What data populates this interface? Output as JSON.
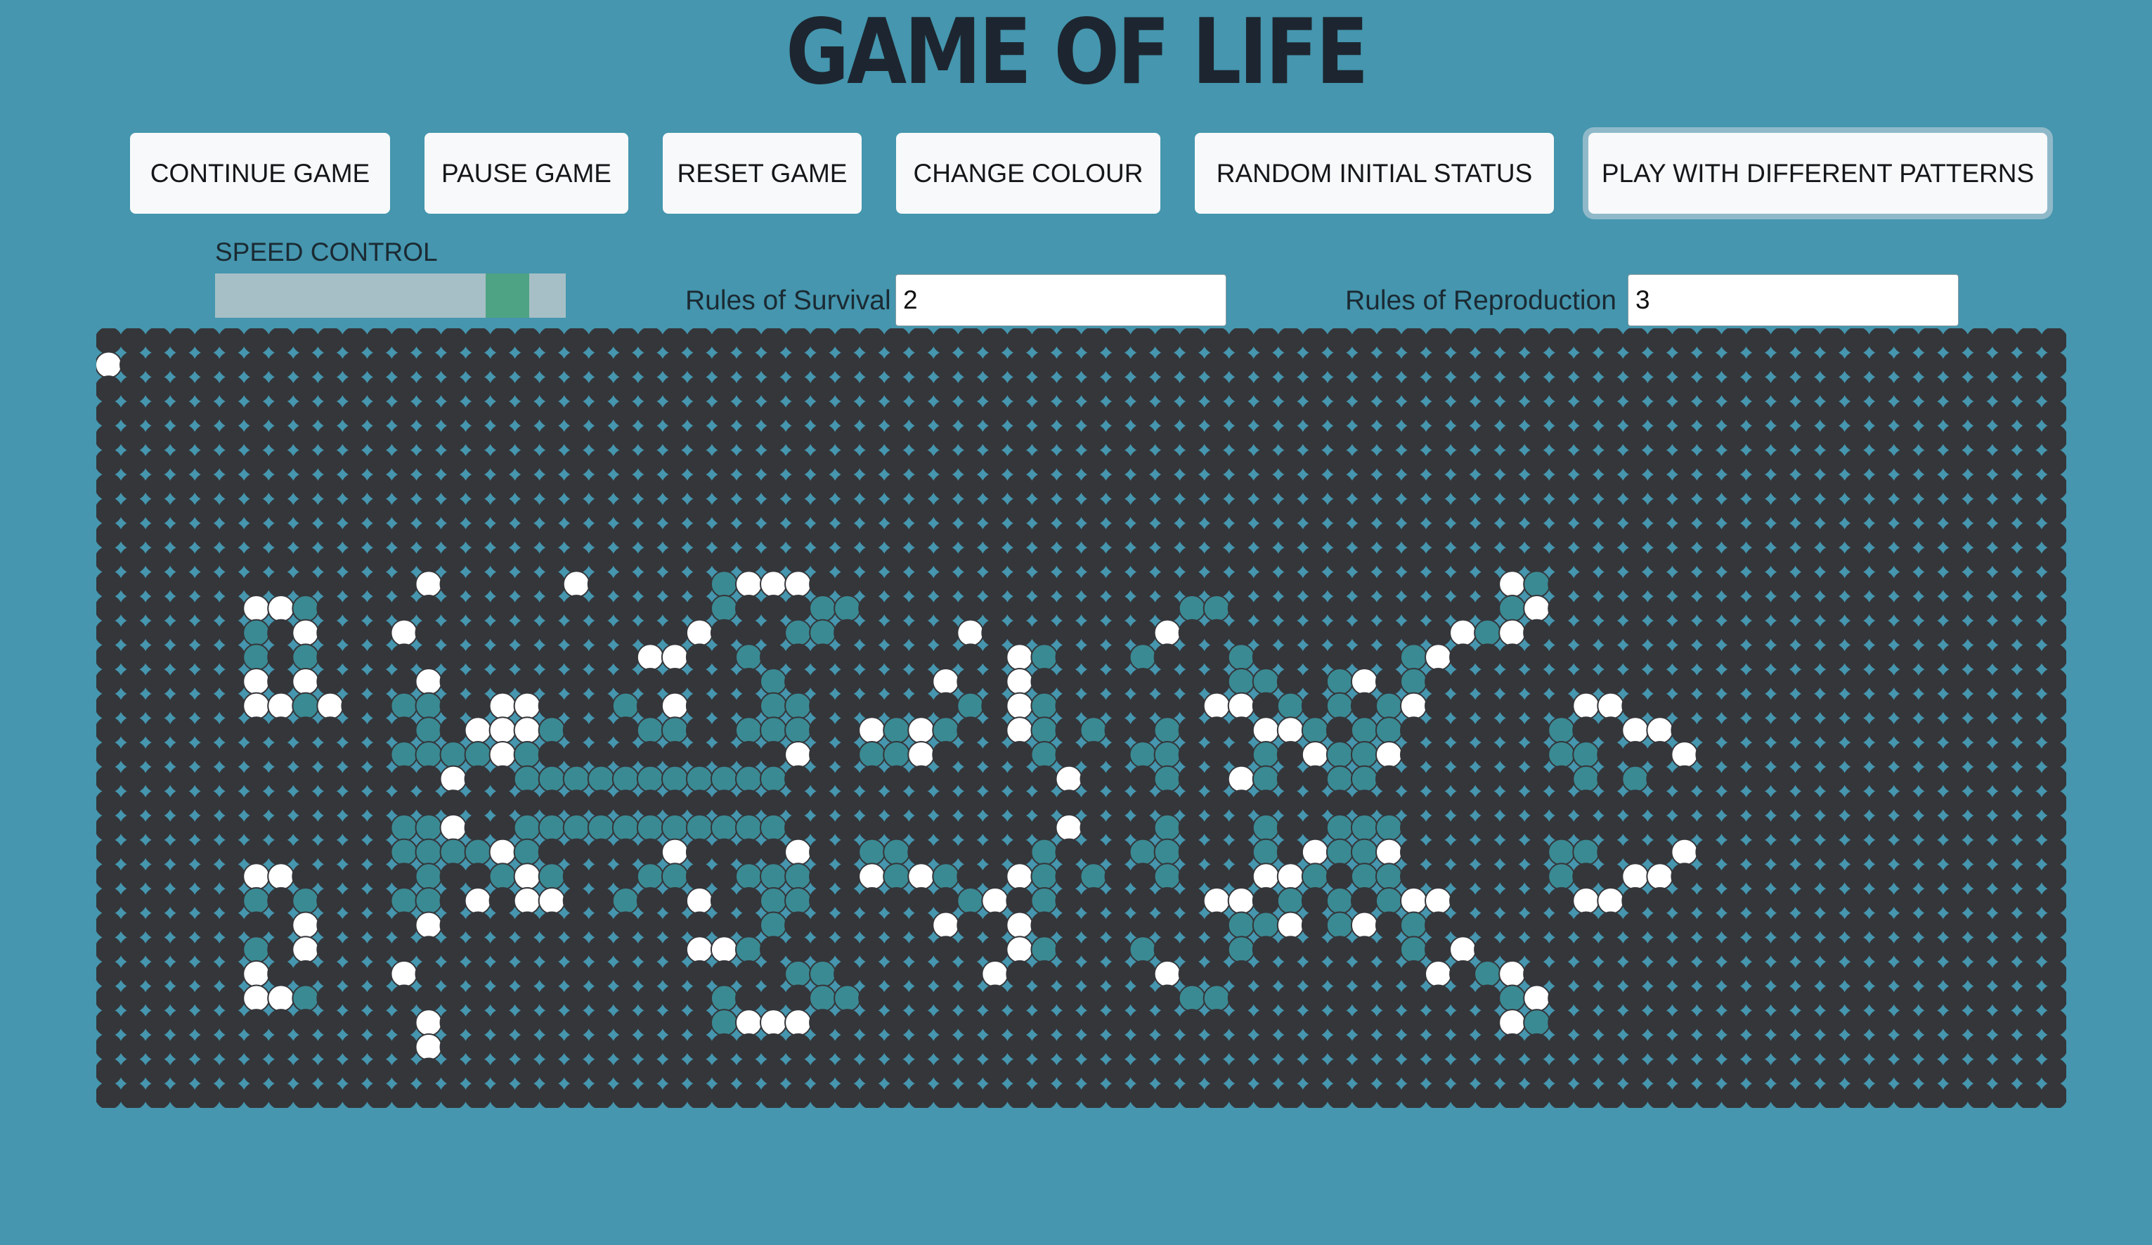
{
  "title": "GAME OF LIFE",
  "buttons": {
    "continue": "CONTINUE GAME",
    "pause": "PAUSE GAME",
    "reset": "RESET GAME",
    "colour": "CHANGE COLOUR",
    "random": "RANDOM INITIAL STATUS",
    "patterns": "PLAY WITH DIFFERENT PATTERNS"
  },
  "speed": {
    "label": "SPEED CONTROL",
    "value": 0.88
  },
  "rules": {
    "survival_label": "Rules of Survival",
    "survival_value": "2",
    "reproduction_label": "Rules of Reproduction",
    "reproduction_value": "3"
  },
  "colors": {
    "background": "#4596ae",
    "dead_cell": "#35363a",
    "alive_cell": "#ffffff",
    "visited_cell": "#3a8a93",
    "title": "#1d2630",
    "button": "#f8f9fa",
    "slider_track": "#a6bfc6",
    "slider_thumb": "#4ea384"
  },
  "board": {
    "cols": 80,
    "rows": 32,
    "alive": [
      [
        0,
        1
      ],
      [
        13,
        10
      ],
      [
        6,
        11
      ],
      [
        7,
        11
      ],
      [
        12,
        11
      ],
      [
        4,
        12
      ],
      [
        10,
        12
      ],
      [
        14,
        12
      ],
      [
        0,
        13
      ],
      [
        1,
        13
      ],
      [
        13,
        13
      ],
      [
        4,
        14
      ],
      [
        12,
        14
      ],
      [
        1,
        15
      ],
      [
        2,
        15
      ],
      [
        3,
        15
      ],
      [
        6,
        15
      ],
      [
        7,
        15
      ],
      [
        10,
        15
      ],
      [
        13,
        15
      ],
      [
        4,
        16
      ],
      [
        6,
        17
      ],
      [
        7,
        17
      ],
      [
        10,
        17
      ],
      [
        13,
        17
      ],
      [
        12,
        18
      ],
      [
        13,
        18
      ],
      [
        4,
        19
      ],
      [
        12,
        19
      ],
      [
        4,
        20
      ],
      [
        10,
        20
      ],
      [
        4,
        21
      ],
      [
        5,
        21
      ],
      [
        12,
        21
      ],
      [
        13,
        22
      ],
      [
        6,
        11
      ],
      [
        6,
        12
      ],
      [
        6,
        13
      ],
      [
        6,
        14
      ],
      [
        6,
        15
      ],
      [
        6,
        22
      ],
      [
        6,
        23
      ],
      [
        6,
        24
      ],
      [
        6,
        25
      ],
      [
        6,
        26
      ],
      [
        12,
        24
      ],
      [
        12,
        25
      ],
      [
        12,
        26
      ],
      [
        12,
        27
      ],
      [
        12,
        28
      ],
      [
        7,
        11
      ],
      [
        7,
        24
      ],
      [
        8,
        12
      ],
      [
        8,
        13
      ],
      [
        8,
        14
      ],
      [
        8,
        25
      ],
      [
        8,
        26
      ],
      [
        8,
        27
      ],
      [
        13,
        12
      ],
      [
        13,
        27
      ],
      [
        22,
        12
      ],
      [
        22,
        13
      ],
      [
        22,
        14
      ],
      [
        22,
        15
      ],
      [
        22,
        16
      ],
      [
        22,
        23
      ],
      [
        22,
        24
      ],
      [
        22,
        25
      ],
      [
        22,
        26
      ],
      [
        22,
        27
      ]
    ],
    "alive_cells": [
      [
        13,
        10
      ],
      [
        6,
        11
      ],
      [
        7,
        11
      ],
      [
        12,
        11
      ],
      [
        4,
        12
      ],
      [
        10,
        12
      ],
      [
        13,
        12
      ],
      [
        4,
        13
      ],
      [
        10,
        13
      ],
      [
        12,
        13
      ],
      [
        4,
        14
      ],
      [
        12,
        14
      ],
      [
        4,
        15
      ],
      [
        6,
        15
      ],
      [
        7,
        15
      ],
      [
        10,
        15
      ],
      [
        13,
        15
      ],
      [
        4,
        16
      ],
      [
        4,
        17
      ],
      [
        6,
        17
      ],
      [
        7,
        17
      ],
      [
        10,
        17
      ],
      [
        13,
        17
      ],
      [
        12,
        18
      ],
      [
        13,
        18
      ],
      [
        4,
        19
      ],
      [
        12,
        19
      ],
      [
        6,
        22
      ],
      [
        7,
        22
      ],
      [
        9,
        22
      ],
      [
        6,
        23
      ],
      [
        9,
        23
      ],
      [
        10,
        23
      ],
      [
        6,
        24
      ],
      [
        9,
        24
      ],
      [
        6,
        25
      ],
      [
        10,
        25
      ],
      [
        6,
        26
      ],
      [
        9,
        26
      ],
      [
        7,
        26
      ],
      [
        12,
        26
      ],
      [
        12,
        27
      ],
      [
        13,
        28
      ]
    ]
  },
  "patterns": {
    "white": [
      [
        13,
        10
      ],
      [
        19,
        10
      ],
      [
        26,
        10
      ],
      [
        27,
        10
      ],
      [
        28,
        10
      ],
      [
        57,
        10
      ],
      [
        6,
        11
      ],
      [
        7,
        11
      ],
      [
        58,
        11
      ],
      [
        8,
        12
      ],
      [
        12,
        12
      ],
      [
        24,
        12
      ],
      [
        35,
        12
      ],
      [
        43,
        12
      ],
      [
        55,
        12
      ],
      [
        57,
        12
      ],
      [
        22,
        13
      ],
      [
        23,
        13
      ],
      [
        37,
        13
      ],
      [
        54,
        13
      ],
      [
        6,
        14
      ],
      [
        8,
        14
      ],
      [
        13,
        14
      ],
      [
        34,
        14
      ],
      [
        37,
        14
      ],
      [
        51,
        14
      ],
      [
        6,
        15
      ],
      [
        7,
        15
      ],
      [
        9,
        15
      ],
      [
        16,
        15
      ],
      [
        17,
        15
      ],
      [
        23,
        15
      ],
      [
        37,
        15
      ],
      [
        45,
        15
      ],
      [
        46,
        15
      ],
      [
        53,
        15
      ],
      [
        60,
        15
      ],
      [
        61,
        15
      ],
      [
        15,
        16
      ],
      [
        16,
        16
      ],
      [
        17,
        16
      ],
      [
        31,
        16
      ],
      [
        33,
        16
      ],
      [
        37,
        16
      ],
      [
        47,
        16
      ],
      [
        48,
        16
      ],
      [
        62,
        16
      ],
      [
        63,
        16
      ],
      [
        16,
        17
      ],
      [
        28,
        17
      ],
      [
        33,
        17
      ],
      [
        49,
        17
      ],
      [
        52,
        17
      ],
      [
        64,
        17
      ],
      [
        14,
        18
      ],
      [
        39,
        18
      ],
      [
        46,
        18
      ],
      [
        14,
        20
      ],
      [
        39,
        20
      ],
      [
        16,
        21
      ],
      [
        23,
        21
      ],
      [
        28,
        21
      ],
      [
        49,
        21
      ],
      [
        52,
        21
      ],
      [
        64,
        21
      ],
      [
        6,
        22
      ],
      [
        7,
        22
      ],
      [
        17,
        22
      ],
      [
        31,
        22
      ],
      [
        33,
        22
      ],
      [
        37,
        22
      ],
      [
        47,
        22
      ],
      [
        48,
        22
      ],
      [
        62,
        22
      ],
      [
        63,
        22
      ],
      [
        15,
        23
      ],
      [
        17,
        23
      ],
      [
        18,
        23
      ],
      [
        24,
        23
      ],
      [
        36,
        23
      ],
      [
        45,
        23
      ],
      [
        46,
        23
      ],
      [
        53,
        23
      ],
      [
        54,
        23
      ],
      [
        60,
        23
      ],
      [
        61,
        23
      ],
      [
        8,
        24
      ],
      [
        13,
        24
      ],
      [
        34,
        24
      ],
      [
        37,
        24
      ],
      [
        48,
        24
      ],
      [
        51,
        24
      ],
      [
        8,
        25
      ],
      [
        24,
        25
      ],
      [
        25,
        25
      ],
      [
        37,
        25
      ],
      [
        55,
        25
      ],
      [
        6,
        26
      ],
      [
        12,
        26
      ],
      [
        36,
        26
      ],
      [
        43,
        26
      ],
      [
        54,
        26
      ],
      [
        57,
        26
      ],
      [
        6,
        27
      ],
      [
        7,
        27
      ],
      [
        58,
        27
      ],
      [
        13,
        28
      ],
      [
        26,
        28
      ],
      [
        27,
        28
      ],
      [
        28,
        28
      ],
      [
        57,
        28
      ],
      [
        13,
        29
      ]
    ],
    "teal": [
      [
        25,
        10
      ],
      [
        58,
        10
      ],
      [
        8,
        11
      ],
      [
        25,
        11
      ],
      [
        29,
        11
      ],
      [
        30,
        11
      ],
      [
        44,
        11
      ],
      [
        45,
        11
      ],
      [
        57,
        11
      ],
      [
        6,
        12
      ],
      [
        28,
        12
      ],
      [
        29,
        12
      ],
      [
        56,
        12
      ],
      [
        6,
        13
      ],
      [
        8,
        13
      ],
      [
        26,
        13
      ],
      [
        38,
        13
      ],
      [
        42,
        13
      ],
      [
        46,
        13
      ],
      [
        53,
        13
      ],
      [
        8,
        14
      ],
      [
        27,
        14
      ],
      [
        46,
        14
      ],
      [
        47,
        14
      ],
      [
        50,
        14
      ],
      [
        53,
        14
      ],
      [
        6,
        15
      ],
      [
        8,
        15
      ],
      [
        12,
        15
      ],
      [
        13,
        15
      ],
      [
        21,
        15
      ],
      [
        27,
        15
      ],
      [
        28,
        15
      ],
      [
        35,
        15
      ],
      [
        38,
        15
      ],
      [
        48,
        15
      ],
      [
        50,
        15
      ],
      [
        52,
        15
      ],
      [
        13,
        16
      ],
      [
        16,
        16
      ],
      [
        18,
        16
      ],
      [
        22,
        16
      ],
      [
        23,
        16
      ],
      [
        26,
        16
      ],
      [
        27,
        16
      ],
      [
        28,
        16
      ],
      [
        32,
        16
      ],
      [
        33,
        16
      ],
      [
        34,
        16
      ],
      [
        38,
        16
      ],
      [
        40,
        16
      ],
      [
        43,
        16
      ],
      [
        47,
        16
      ],
      [
        49,
        16
      ],
      [
        51,
        16
      ],
      [
        52,
        16
      ],
      [
        59,
        16
      ],
      [
        12,
        17
      ],
      [
        13,
        17
      ],
      [
        14,
        17
      ],
      [
        15,
        17
      ],
      [
        17,
        17
      ],
      [
        31,
        17
      ],
      [
        32,
        17
      ],
      [
        38,
        17
      ],
      [
        42,
        17
      ],
      [
        43,
        17
      ],
      [
        47,
        17
      ],
      [
        50,
        17
      ],
      [
        51,
        17
      ],
      [
        59,
        17
      ],
      [
        60,
        17
      ],
      [
        17,
        18
      ],
      [
        18,
        18
      ],
      [
        19,
        18
      ],
      [
        20,
        18
      ],
      [
        21,
        18
      ],
      [
        22,
        18
      ],
      [
        23,
        18
      ],
      [
        24,
        18
      ],
      [
        25,
        18
      ],
      [
        26,
        18
      ],
      [
        27,
        18
      ],
      [
        39,
        18
      ],
      [
        43,
        18
      ],
      [
        47,
        18
      ],
      [
        50,
        18
      ],
      [
        51,
        18
      ],
      [
        60,
        18
      ],
      [
        62,
        18
      ],
      [
        12,
        20
      ],
      [
        13,
        20
      ],
      [
        17,
        20
      ],
      [
        18,
        20
      ],
      [
        19,
        20
      ],
      [
        20,
        20
      ],
      [
        21,
        20
      ],
      [
        22,
        20
      ],
      [
        23,
        20
      ],
      [
        24,
        20
      ],
      [
        25,
        20
      ],
      [
        26,
        20
      ],
      [
        27,
        20
      ],
      [
        39,
        20
      ],
      [
        43,
        20
      ],
      [
        47,
        20
      ],
      [
        50,
        20
      ],
      [
        51,
        20
      ],
      [
        52,
        20
      ],
      [
        12,
        21
      ],
      [
        13,
        21
      ],
      [
        14,
        21
      ],
      [
        15,
        21
      ],
      [
        17,
        21
      ],
      [
        31,
        21
      ],
      [
        32,
        21
      ],
      [
        38,
        21
      ],
      [
        42,
        21
      ],
      [
        43,
        21
      ],
      [
        47,
        21
      ],
      [
        50,
        21
      ],
      [
        51,
        21
      ],
      [
        59,
        21
      ],
      [
        60,
        21
      ],
      [
        13,
        22
      ],
      [
        16,
        22
      ],
      [
        18,
        22
      ],
      [
        22,
        22
      ],
      [
        23,
        22
      ],
      [
        26,
        22
      ],
      [
        27,
        22
      ],
      [
        28,
        22
      ],
      [
        32,
        22
      ],
      [
        33,
        22
      ],
      [
        34,
        22
      ],
      [
        38,
        22
      ],
      [
        40,
        22
      ],
      [
        43,
        22
      ],
      [
        47,
        22
      ],
      [
        49,
        22
      ],
      [
        51,
        22
      ],
      [
        52,
        22
      ],
      [
        59,
        22
      ],
      [
        6,
        23
      ],
      [
        8,
        23
      ],
      [
        12,
        23
      ],
      [
        13,
        23
      ],
      [
        21,
        23
      ],
      [
        27,
        23
      ],
      [
        28,
        23
      ],
      [
        35,
        23
      ],
      [
        38,
        23
      ],
      [
        48,
        23
      ],
      [
        50,
        23
      ],
      [
        52,
        23
      ],
      [
        8,
        24
      ],
      [
        27,
        24
      ],
      [
        46,
        24
      ],
      [
        47,
        24
      ],
      [
        50,
        24
      ],
      [
        53,
        24
      ],
      [
        6,
        25
      ],
      [
        8,
        25
      ],
      [
        26,
        25
      ],
      [
        38,
        25
      ],
      [
        42,
        25
      ],
      [
        46,
        25
      ],
      [
        53,
        25
      ],
      [
        6,
        26
      ],
      [
        28,
        26
      ],
      [
        29,
        26
      ],
      [
        56,
        26
      ],
      [
        8,
        27
      ],
      [
        25,
        27
      ],
      [
        29,
        27
      ],
      [
        30,
        27
      ],
      [
        44,
        27
      ],
      [
        45,
        27
      ],
      [
        57,
        27
      ],
      [
        25,
        28
      ],
      [
        58,
        28
      ]
    ]
  }
}
